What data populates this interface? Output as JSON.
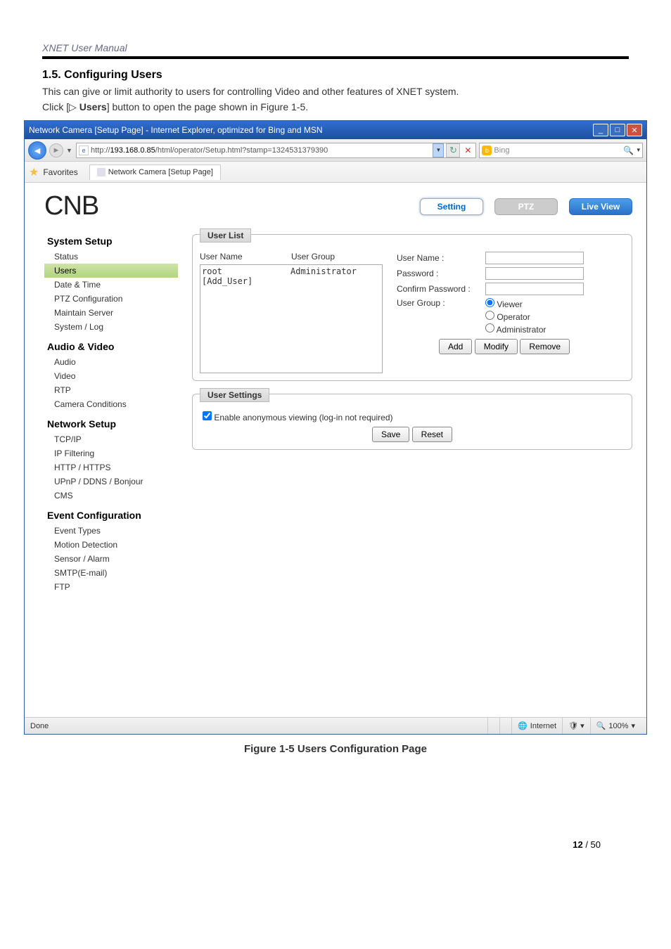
{
  "doc": {
    "header": "XNET User Manual",
    "section_title": "1.5. Configuring Users",
    "desc": "This can give or limit authority to users for controlling Video and other features of XNET system.",
    "click_prefix": "Click [▷ ",
    "click_bold": "Users",
    "click_suffix": "] button to open the page shown in Figure 1-5.",
    "figure_caption": "Figure 1-5 Users Configuration Page",
    "page_current": "12",
    "page_total": " / 50"
  },
  "ie": {
    "title": "Network Camera [Setup Page] - Internet Explorer, optimized for Bing and MSN",
    "url_prefix": "http://",
    "url_host": "193.168.0.85",
    "url_path": "/html/operator/Setup.html?stamp=1324531379390",
    "search_engine": "Bing",
    "favorites_label": "Favorites",
    "tab_label": "Network Camera [Setup Page]",
    "status_left": "Done",
    "status_zone": "Internet",
    "status_zoom": "100%"
  },
  "page": {
    "logo": "CNB",
    "topbtns": {
      "setting": "Setting",
      "ptz": "PTZ",
      "live": "Live View"
    },
    "nav": {
      "system": {
        "title": "System Setup",
        "items": [
          "Status",
          "Users",
          "Date & Time",
          "PTZ Configuration",
          "Maintain Server",
          "System / Log"
        ]
      },
      "av": {
        "title": "Audio & Video",
        "items": [
          "Audio",
          "Video",
          "RTP",
          "Camera Conditions"
        ]
      },
      "net": {
        "title": "Network Setup",
        "items": [
          "TCP/IP",
          "IP Filtering",
          "HTTP / HTTPS",
          "UPnP / DDNS / Bonjour",
          "CMS"
        ]
      },
      "event": {
        "title": "Event Configuration",
        "items": [
          "Event Types",
          "Motion Detection",
          "Sensor / Alarm",
          "SMTP(E-mail)",
          "FTP"
        ]
      }
    },
    "userlist": {
      "box_title": "User List",
      "col_user": "User Name",
      "col_group": "User Group",
      "rows": [
        {
          "name": "root",
          "group": "Administrator"
        },
        {
          "name": "[Add_User]",
          "group": ""
        }
      ]
    },
    "form": {
      "user_name_label": "User Name :",
      "password_label": "Password :",
      "confirm_label": "Confirm Password :",
      "group_label": "User Group :",
      "radio_viewer": "Viewer",
      "radio_operator": "Operator",
      "radio_admin": "Administrator",
      "btn_add": "Add",
      "btn_modify": "Modify",
      "btn_remove": "Remove"
    },
    "settings": {
      "box_title": "User Settings",
      "anon_label": "Enable anonymous viewing (log-in not required)",
      "btn_save": "Save",
      "btn_reset": "Reset"
    }
  }
}
